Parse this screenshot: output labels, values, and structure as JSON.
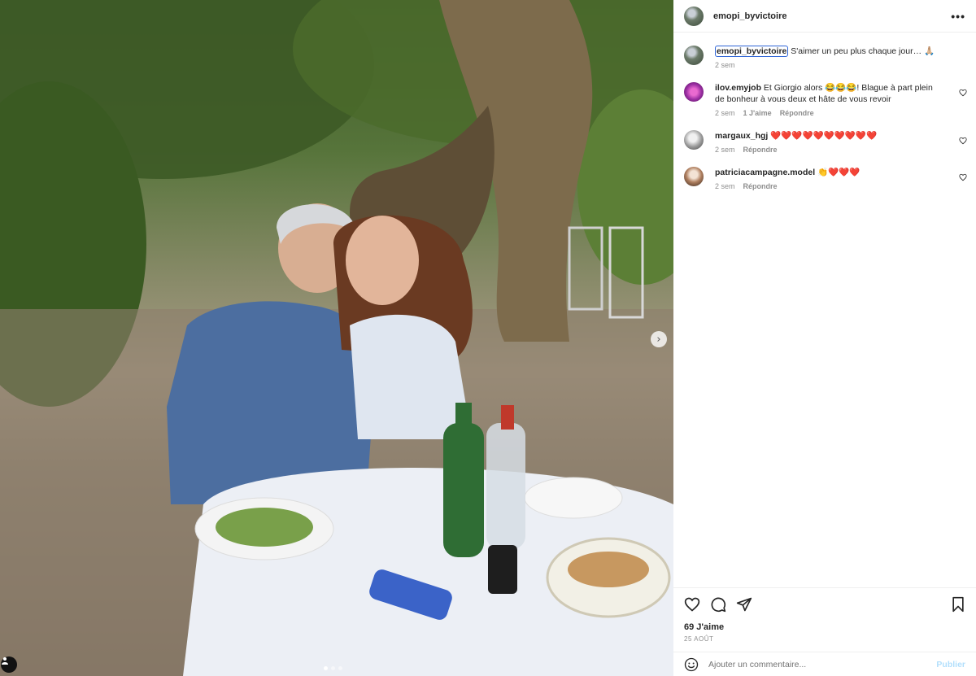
{
  "post": {
    "username": "emopi_byvictoire",
    "caption": "S'aimer un peu plus chaque jour… 🙏🏼",
    "caption_time": "2 sem",
    "likes": "69 J'aime",
    "date": "25 AOÛT",
    "more_label": "•••",
    "carousel_next": "›"
  },
  "comments": [
    {
      "username": "ilov.emyjob",
      "text": "Et Giorgio alors 😂😂😂! Blague à part plein de bonheur à vous deux et hâte de vous revoir",
      "time": "2 sem",
      "likes": "1 J'aime",
      "reply": "Répondre"
    },
    {
      "username": "margaux_hgj",
      "text": "❤️❤️❤️❤️❤️❤️❤️❤️❤️❤️",
      "time": "2 sem",
      "reply": "Répondre"
    },
    {
      "username": "patriciacampagne.model",
      "text": "👏❤️❤️❤️",
      "time": "2 sem",
      "reply": "Répondre"
    }
  ],
  "composer": {
    "placeholder": "Ajouter un commentaire...",
    "post_label": "Publier"
  },
  "icons": {
    "like": "heart-icon",
    "comment": "comment-icon",
    "share": "share-icon",
    "save": "bookmark-icon",
    "emoji": "emoji-icon",
    "tag": "user-tag-icon"
  },
  "colors": {
    "accent": "#0095f6",
    "post_disabled": "#b2dffc",
    "secondary_text": "#8e8e8e"
  }
}
